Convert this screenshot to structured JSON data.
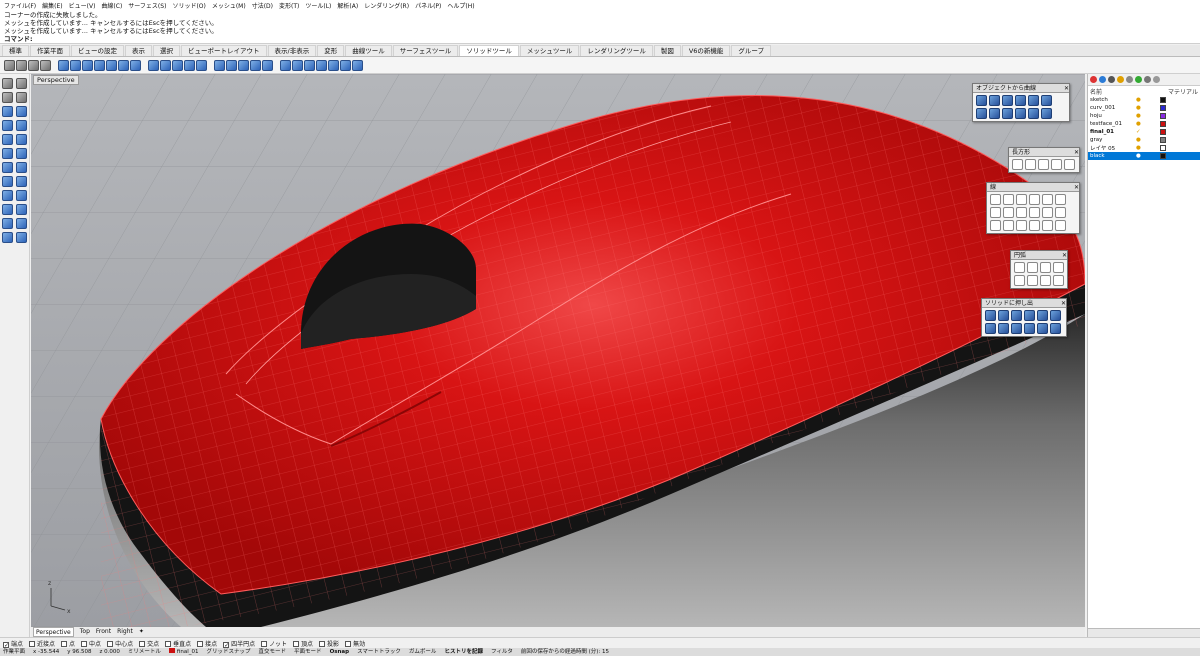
{
  "menu": [
    "ファイル(F)",
    "編集(E)",
    "ビュー(V)",
    "曲線(C)",
    "サーフェス(S)",
    "ソリッド(O)",
    "メッシュ(M)",
    "寸法(D)",
    "変形(T)",
    "ツール(L)",
    "解析(A)",
    "レンダリング(R)",
    "パネル(P)",
    "ヘルプ(H)"
  ],
  "command_history": [
    "コーナーの作成に失敗しました。",
    "メッシュを作成しています... キャンセルするにはEscを押してください。",
    "メッシュを作成しています... キャンセルするにはEscを押してください。"
  ],
  "command_prompt": "コマンド:",
  "toolbar_tabs": [
    "標準",
    "作業平面",
    "ビューの設定",
    "表示",
    "選択",
    "ビューポートレイアウト",
    "表示/非表示",
    "変形",
    "曲線ツール",
    "サーフェスツール",
    "ソリッドツール",
    "メッシュツール",
    "レンダリングツール",
    "製図",
    "V6の新機能",
    "グループ"
  ],
  "active_tab": "ソリッドツール",
  "viewport": {
    "label": "Perspective",
    "tabs": [
      "Perspective",
      "Top",
      "Front",
      "Right"
    ],
    "axis_labels": [
      "z",
      "x"
    ],
    "colors": {
      "background": "#a9abb0",
      "body_red": "#d40f0f",
      "base_black": "#151515",
      "wire": "#ff5b5b"
    }
  },
  "float_panels": [
    {
      "title": "オブジェクトから曲線"
    },
    {
      "title": "長方形"
    },
    {
      "title": "線"
    },
    {
      "title": "円弧"
    },
    {
      "title": "ソリッドに押し出"
    }
  ],
  "layers_panel": {
    "col_name": "名前",
    "col_material": "マテリアル",
    "layers": [
      {
        "name": "sketch",
        "color": "#111111",
        "current": false,
        "selected": false
      },
      {
        "name": "curv_001",
        "color": "#2a2ad0",
        "current": false,
        "selected": false
      },
      {
        "name": "hoju",
        "color": "#8a2be2",
        "current": false,
        "selected": false
      },
      {
        "name": "testface_01",
        "color": "#cc1111",
        "current": false,
        "selected": false
      },
      {
        "name": "final_01",
        "color": "#cc1111",
        "current": true,
        "selected": false
      },
      {
        "name": "gray",
        "color": "#808080",
        "current": false,
        "selected": false
      },
      {
        "name": "レイヤ 05",
        "color": "#ffffff",
        "current": false,
        "selected": false
      },
      {
        "name": "black",
        "color": "#111111",
        "current": false,
        "selected": true
      }
    ]
  },
  "osnap": [
    {
      "label": "端点",
      "checked": true
    },
    {
      "label": "近接点",
      "checked": false
    },
    {
      "label": "点",
      "checked": false
    },
    {
      "label": "中点",
      "checked": false
    },
    {
      "label": "中心点",
      "checked": false
    },
    {
      "label": "交点",
      "checked": false
    },
    {
      "label": "垂直点",
      "checked": false
    },
    {
      "label": "接点",
      "checked": false
    },
    {
      "label": "四半円点",
      "checked": true
    },
    {
      "label": "ノット",
      "checked": false
    },
    {
      "label": "頂点",
      "checked": false
    },
    {
      "label": "投影",
      "checked": false
    },
    {
      "label": "無効",
      "checked": false
    }
  ],
  "status_bar": {
    "plane": "作業平面",
    "x": "x -35.544",
    "y": "y 96.508",
    "z": "z 0.000",
    "units": "ミリメートル",
    "layer": "final_01",
    "layer_color": "#cc1111",
    "toggles": [
      "グリッドスナップ",
      "直交モード",
      "平面モード",
      "Osnap",
      "スマートトラック",
      "ガムボール",
      "ヒストリを記録",
      "フィルタ"
    ],
    "message": "前回の保存からの経過時間 (分): 15"
  }
}
